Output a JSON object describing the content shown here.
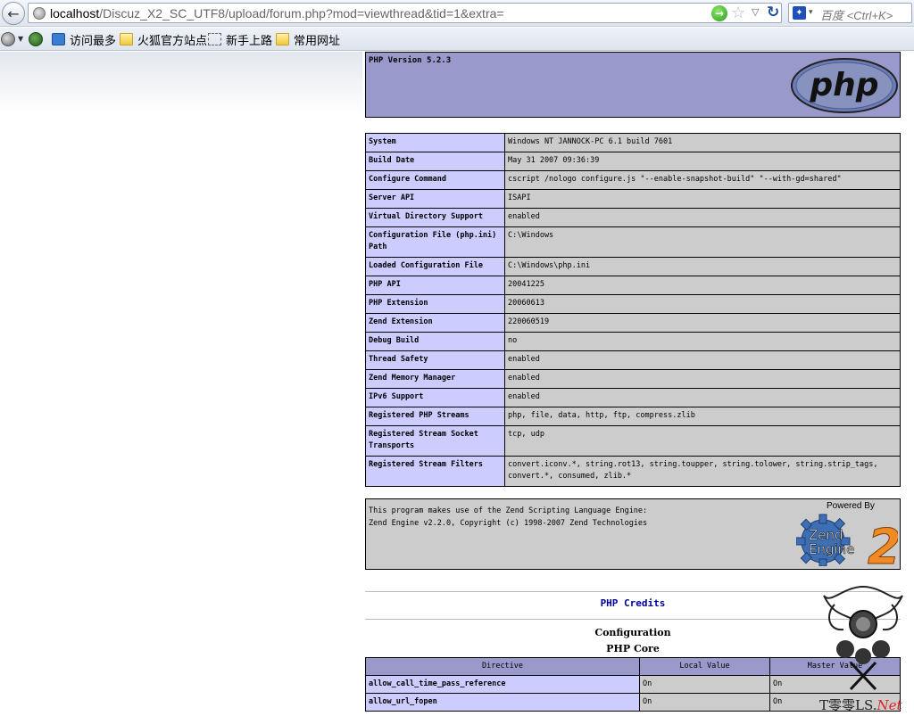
{
  "browser": {
    "url_host": "localhost",
    "url_path": "/Discuz_X2_SC_UTF8/upload/forum.php?mod=viewthread&tid=1&extra=",
    "search_placeholder": "百度 <Ctrl+K>",
    "bookmarks": [
      {
        "label": "访问最多",
        "icon": "search-icon"
      },
      {
        "label": "火狐官方站点",
        "icon": "folder-icon"
      },
      {
        "label": "新手上路",
        "icon": "page-icon"
      },
      {
        "label": "常用网址",
        "icon": "folder-icon"
      }
    ]
  },
  "phpinfo": {
    "version_title": "PHP Version 5.2.3",
    "logo_text": "php",
    "system_rows": [
      {
        "key": "System",
        "value": "Windows NT JANNOCK-PC 6.1 build 7601"
      },
      {
        "key": "Build Date",
        "value": "May 31 2007 09:36:39"
      },
      {
        "key": "Configure Command",
        "value": "cscript /nologo configure.js \"--enable-snapshot-build\" \"--with-gd=shared\""
      },
      {
        "key": "Server API",
        "value": "ISAPI"
      },
      {
        "key": "Virtual Directory Support",
        "value": "enabled"
      },
      {
        "key": "Configuration File (php.ini) Path",
        "value": "C:\\Windows"
      },
      {
        "key": "Loaded Configuration File",
        "value": "C:\\Windows\\php.ini"
      },
      {
        "key": "PHP API",
        "value": "20041225"
      },
      {
        "key": "PHP Extension",
        "value": "20060613"
      },
      {
        "key": "Zend Extension",
        "value": "220060519"
      },
      {
        "key": "Debug Build",
        "value": "no"
      },
      {
        "key": "Thread Safety",
        "value": "enabled"
      },
      {
        "key": "Zend Memory Manager",
        "value": "enabled"
      },
      {
        "key": "IPv6 Support",
        "value": "enabled"
      },
      {
        "key": "Registered PHP Streams",
        "value": "php, file, data, http, ftp, compress.zlib"
      },
      {
        "key": "Registered Stream Socket Transports",
        "value": "tcp, udp"
      },
      {
        "key": "Registered Stream Filters",
        "value": "convert.iconv.*, string.rot13, string.toupper, string.tolower, string.strip_tags, convert.*, consumed, zlib.*"
      }
    ],
    "zend_line1": "This program makes use of the Zend Scripting Language Engine:",
    "zend_line2": "Zend Engine v2.2.0, Copyright (c) 1998-2007 Zend Technologies",
    "powered_by": "Powered By",
    "zend_logo_line1": "Zend",
    "zend_logo_line2": "Engine",
    "zend_logo_num": "2",
    "credits": "PHP Credits",
    "configuration": "Configuration",
    "core": "PHP Core",
    "directive_headers": [
      "Directive",
      "Local Value",
      "Master Value"
    ],
    "directive_rows": [
      {
        "name": "allow_call_time_pass_reference",
        "local": "On",
        "master": "On"
      },
      {
        "name": "allow_url_fopen",
        "local": "On",
        "master": "On"
      }
    ]
  },
  "watermark": {
    "text_main": "T零零LS.",
    "text_net": "Net"
  },
  "colors": {
    "php_header": "#9999cc",
    "key_cell": "#ccccff",
    "value_cell": "#cccccc",
    "credits_link": "#000099"
  }
}
